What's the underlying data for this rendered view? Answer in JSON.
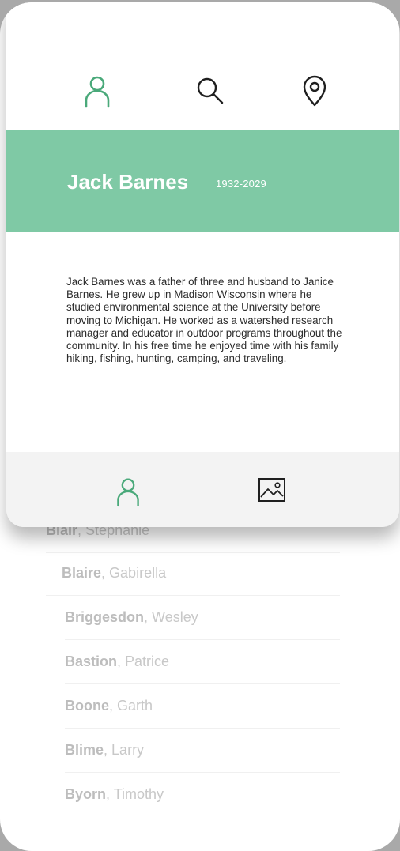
{
  "profile": {
    "name": "Jack Barnes",
    "years": "1932-2029",
    "bio": "Jack Barnes was a father of three and husband to Janice Barnes. He grew up in Madison Wisconsin where he studied environmental science at the University before moving to Michigan. He worked as a watershed research manager and educator in outdoor programs throughout the community. In his free time he enjoyed time with his family hiking, fishing, hunting, camping, and traveling."
  },
  "top_icons": [
    "person-icon",
    "search-icon",
    "location-pin-icon"
  ],
  "bottom_nav_icons": [
    "person-icon",
    "image-icon"
  ],
  "colors": {
    "accent": "#7fc9a5",
    "icon_green": "#4aa97a",
    "icon_dark": "#1f1f1f"
  },
  "list": [
    {
      "last": "Blair",
      "first": "Stephanie"
    },
    {
      "last": "Blaire",
      "first": "Gabirella"
    },
    {
      "last": "Briggesdon",
      "first": "Wesley"
    },
    {
      "last": "Bastion",
      "first": "Patrice"
    },
    {
      "last": "Boone",
      "first": "Garth"
    },
    {
      "last": "Blime",
      "first": "Larry"
    },
    {
      "last": "Byorn",
      "first": "Timothy"
    }
  ]
}
